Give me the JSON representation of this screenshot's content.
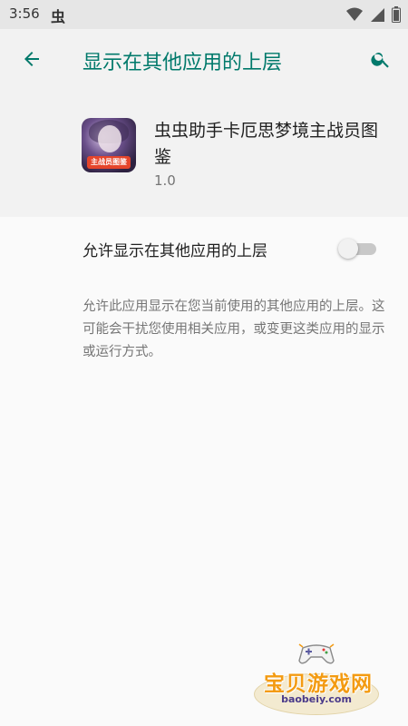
{
  "status_bar": {
    "time": "3:56",
    "app_glyph": "虫",
    "icons": [
      "wifi-icon",
      "signal-icon",
      "battery-icon"
    ]
  },
  "app_bar": {
    "title": "显示在其他应用的上层",
    "back_icon": "arrow-left-icon",
    "search_icon": "search-icon",
    "accent_color": "#00796b"
  },
  "app_info": {
    "name": "虫虫助手卡厄思梦境主战员图鉴",
    "version": "1.0",
    "icon_banner": "主战员图鉴"
  },
  "permission": {
    "label": "允许显示在其他应用的上层",
    "enabled": false,
    "description": "允许此应用显示在您当前使用的其他应用的上层。这可能会干扰您使用相关应用，或变更这类应用的显示或运行方式。"
  },
  "watermark": {
    "text": "宝贝游戏网",
    "url": "baobeiy.com"
  }
}
